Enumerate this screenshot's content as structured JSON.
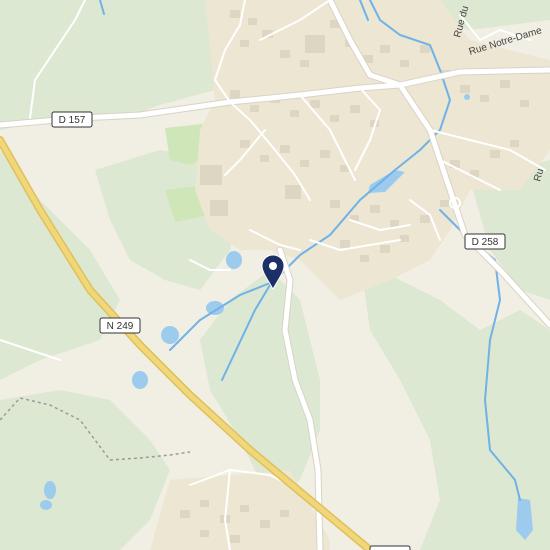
{
  "map": {
    "colors": {
      "land": "#f1eee4",
      "forest": "#dde8d2",
      "park": "#cfe6b8",
      "urban": "#ece6d3",
      "water": "#9ccbee",
      "stream": "#6fb2e8",
      "road": "#ffffff",
      "road_casing": "#d8d3c6",
      "highway": "#f0d77a",
      "highway_casing": "#e0c05a",
      "building": "#ddd6c3",
      "pin": "#1c2f66"
    },
    "route_shields": [
      {
        "id": "d157",
        "label": "D 157"
      },
      {
        "id": "n249",
        "label": "N 249"
      },
      {
        "id": "d258",
        "label": "D 258"
      }
    ],
    "street_labels": [
      {
        "id": "rue-notre-dame",
        "text": "Rue Notre-Dame"
      },
      {
        "id": "rue-du",
        "text": "Rue du"
      },
      {
        "id": "rue-right",
        "text": "Ru"
      }
    ],
    "marker": {
      "icon": "map-pin-icon"
    }
  }
}
